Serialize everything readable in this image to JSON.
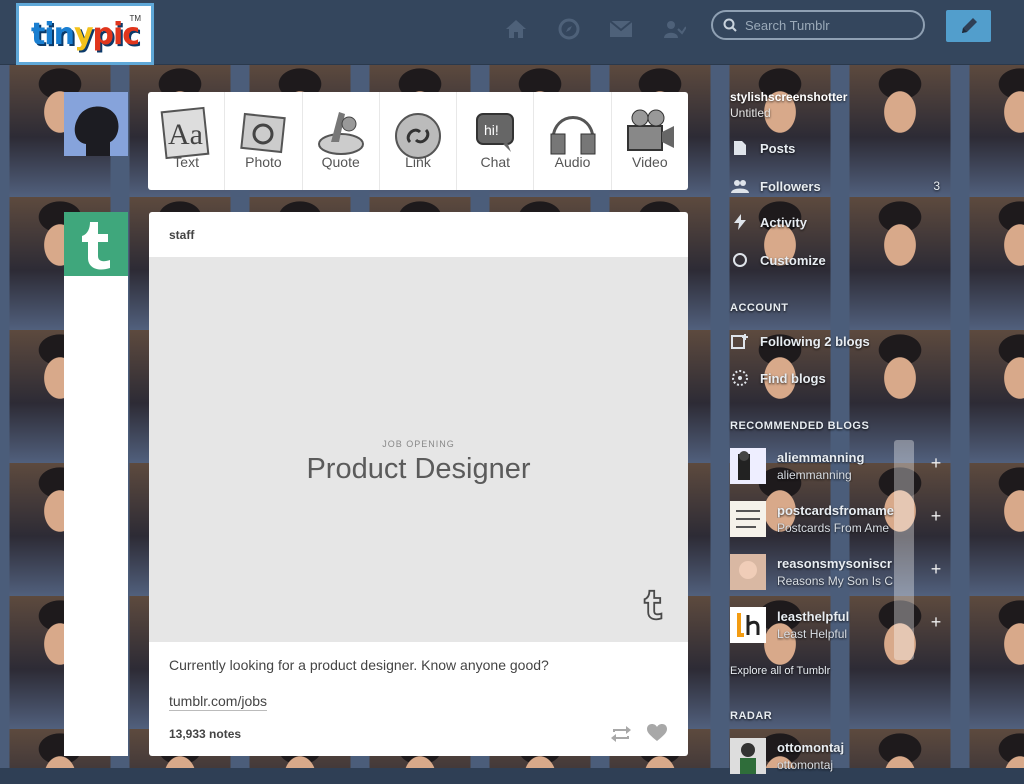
{
  "app": {
    "logo": {
      "text_left": "tin",
      "text_mid": "y",
      "text_right": "pic",
      "tm": "TM"
    }
  },
  "topbar": {
    "icons": [
      "home-icon",
      "compass-icon",
      "mail-icon",
      "people-icon"
    ],
    "search_placeholder": "Search Tumblr",
    "compose_icon": "pencil-icon"
  },
  "post_types": [
    {
      "label": "Text",
      "icon": "text-aa-icon"
    },
    {
      "label": "Photo",
      "icon": "camera-icon"
    },
    {
      "label": "Quote",
      "icon": "quote-icon"
    },
    {
      "label": "Link",
      "icon": "link-icon"
    },
    {
      "label": "Chat",
      "icon": "chat-bubble-icon"
    },
    {
      "label": "Audio",
      "icon": "headphones-icon"
    },
    {
      "label": "Video",
      "icon": "video-camera-icon"
    }
  ],
  "post": {
    "author": "staff",
    "kicker": "JOB OPENING",
    "headline": "Product Designer",
    "body": "Currently looking for a product designer. Know anyone good?",
    "link": "tumblr.com/jobs",
    "notes": "13,933 notes"
  },
  "sidebar": {
    "blog_name": "stylishscreenshotter",
    "blog_subtitle": "Untitled",
    "rows": [
      {
        "label": "Posts",
        "count": ""
      },
      {
        "label": "Followers",
        "count": "3"
      },
      {
        "label": "Activity",
        "count": ""
      },
      {
        "label": "Customize",
        "count": ""
      }
    ],
    "account_header": "ACCOUNT",
    "following": "Following 2 blogs",
    "find_blogs": "Find blogs",
    "recommended_header": "RECOMMENDED BLOGS",
    "recommended": [
      {
        "name": "aliemmanning",
        "sub": "aliemmanning"
      },
      {
        "name": "postcardsfromame",
        "sub": "Postcards From Ame"
      },
      {
        "name": "reasonsmysoniscr",
        "sub": "Reasons My Son Is C"
      },
      {
        "name": "leasthelpful",
        "sub": "Least Helpful"
      }
    ],
    "explore": "Explore all of Tumblr",
    "radar_header": "RADAR",
    "radar": {
      "name": "ottomontaj",
      "sub": "ottomontaj"
    }
  },
  "colors": {
    "topbar": "#34465d",
    "compose": "#529ecc",
    "staff_avatar": "#3fa77c"
  }
}
